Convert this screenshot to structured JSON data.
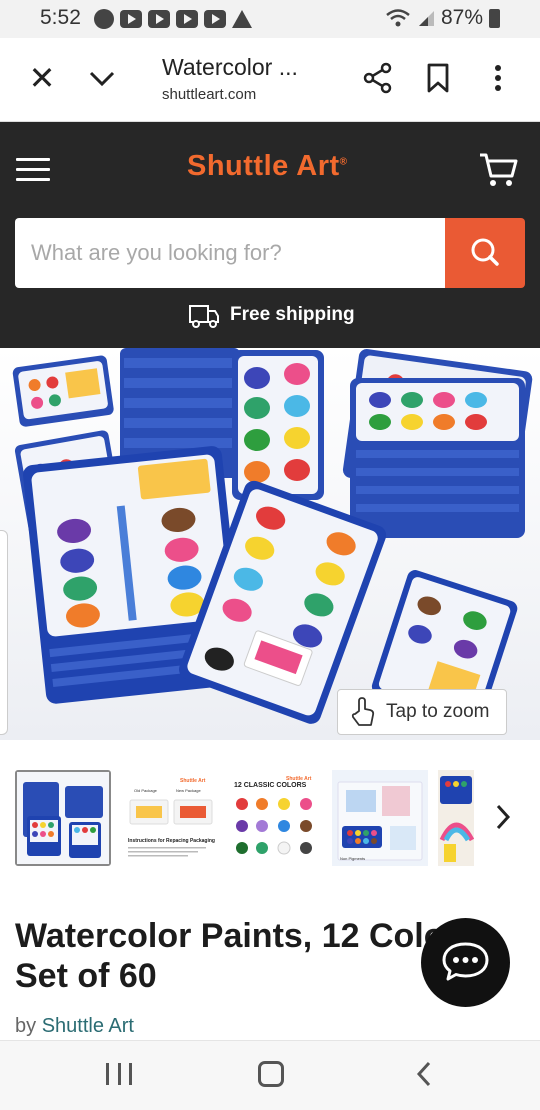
{
  "status_bar": {
    "time": "5:52",
    "battery": "87%"
  },
  "browser": {
    "page_title": "Watercolor ...",
    "domain": "shuttleart.com"
  },
  "site": {
    "brand": "Shuttle Art",
    "search_placeholder": "What are you looking for?",
    "shipping_label": "Free shipping",
    "accent_color": "#ea5a34",
    "header_bg": "#272727"
  },
  "gallery": {
    "zoom_label": "Tap to zoom",
    "thumb2_label_a": "Shuttle Art",
    "thumb2_label_b": "Old Package",
    "thumb2_label_c": "New Package",
    "thumb2_caption": "Instructions for Repacing Packaging",
    "thumb3_title": "12 CLASSIC COLORS",
    "thumb3_brand": "Shuttle Art",
    "thumb4_caption": "Non Pigments"
  },
  "product": {
    "title": "Watercolor Paints, 12 Colors - Set of 60",
    "by_prefix": "by",
    "brand_link": "Shuttle Art"
  }
}
